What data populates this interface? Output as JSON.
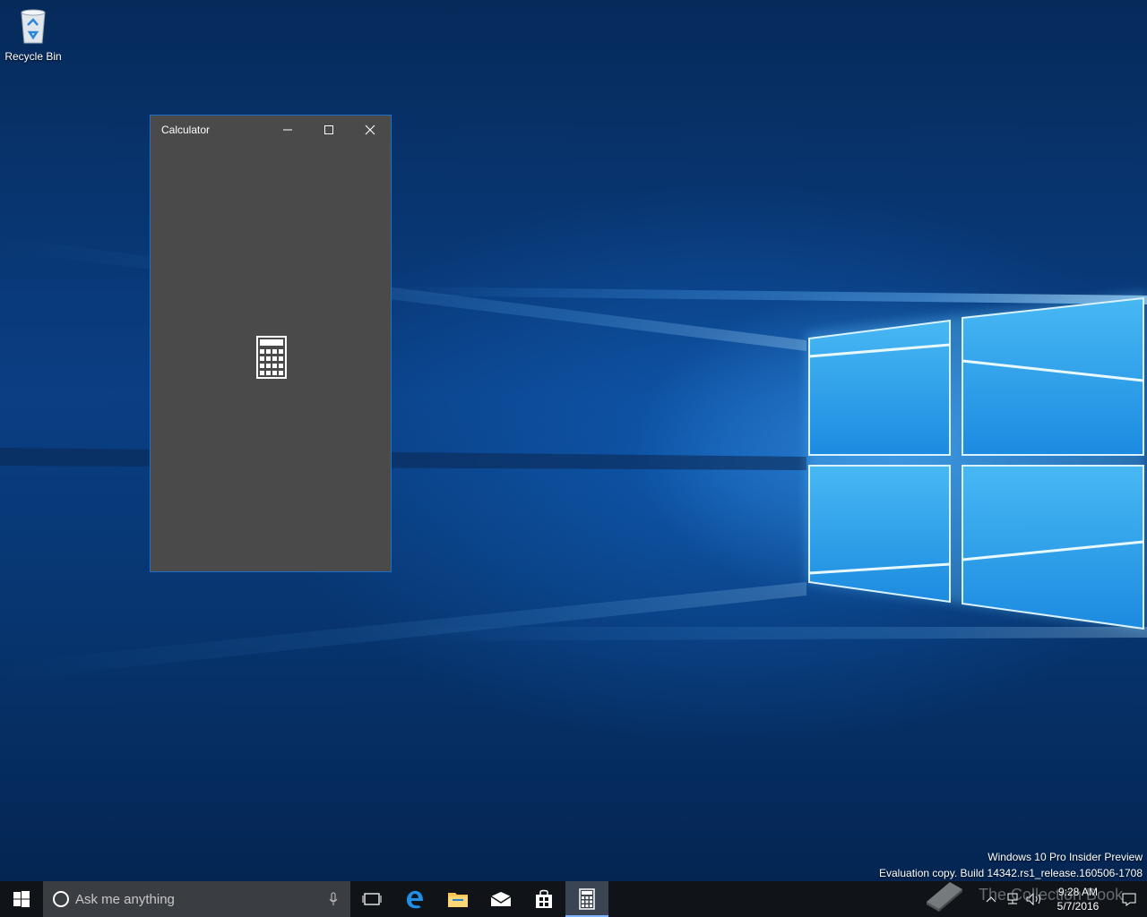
{
  "desktop": {
    "icons": [
      {
        "label": "Recycle Bin",
        "icon": "recycle-bin-icon"
      }
    ],
    "watermark": {
      "line1": "Windows 10 Pro Insider Preview",
      "line2": "Evaluation copy. Build 14342.rs1_release.160506-1708"
    }
  },
  "window": {
    "title": "Calculator",
    "border_color": "#1e6fc8",
    "background": "#4a4a4a",
    "splash_icon": "calculator-icon"
  },
  "taskbar": {
    "search_placeholder": "Ask me anything",
    "pinned": [
      {
        "name": "task-view",
        "icon": "task-view-icon"
      },
      {
        "name": "edge",
        "icon": "edge-icon"
      },
      {
        "name": "file-explorer",
        "icon": "folder-icon"
      },
      {
        "name": "mail",
        "icon": "mail-icon"
      },
      {
        "name": "store",
        "icon": "store-icon"
      },
      {
        "name": "calculator",
        "icon": "calculator-icon",
        "active": true
      }
    ],
    "clock": {
      "time": "9:28 AM",
      "date": "5/7/2016"
    },
    "brand_text": "The Collection Book"
  },
  "colors": {
    "accent": "#1e6fc8",
    "taskbar": "#101418",
    "search_box": "#3a3d42"
  }
}
